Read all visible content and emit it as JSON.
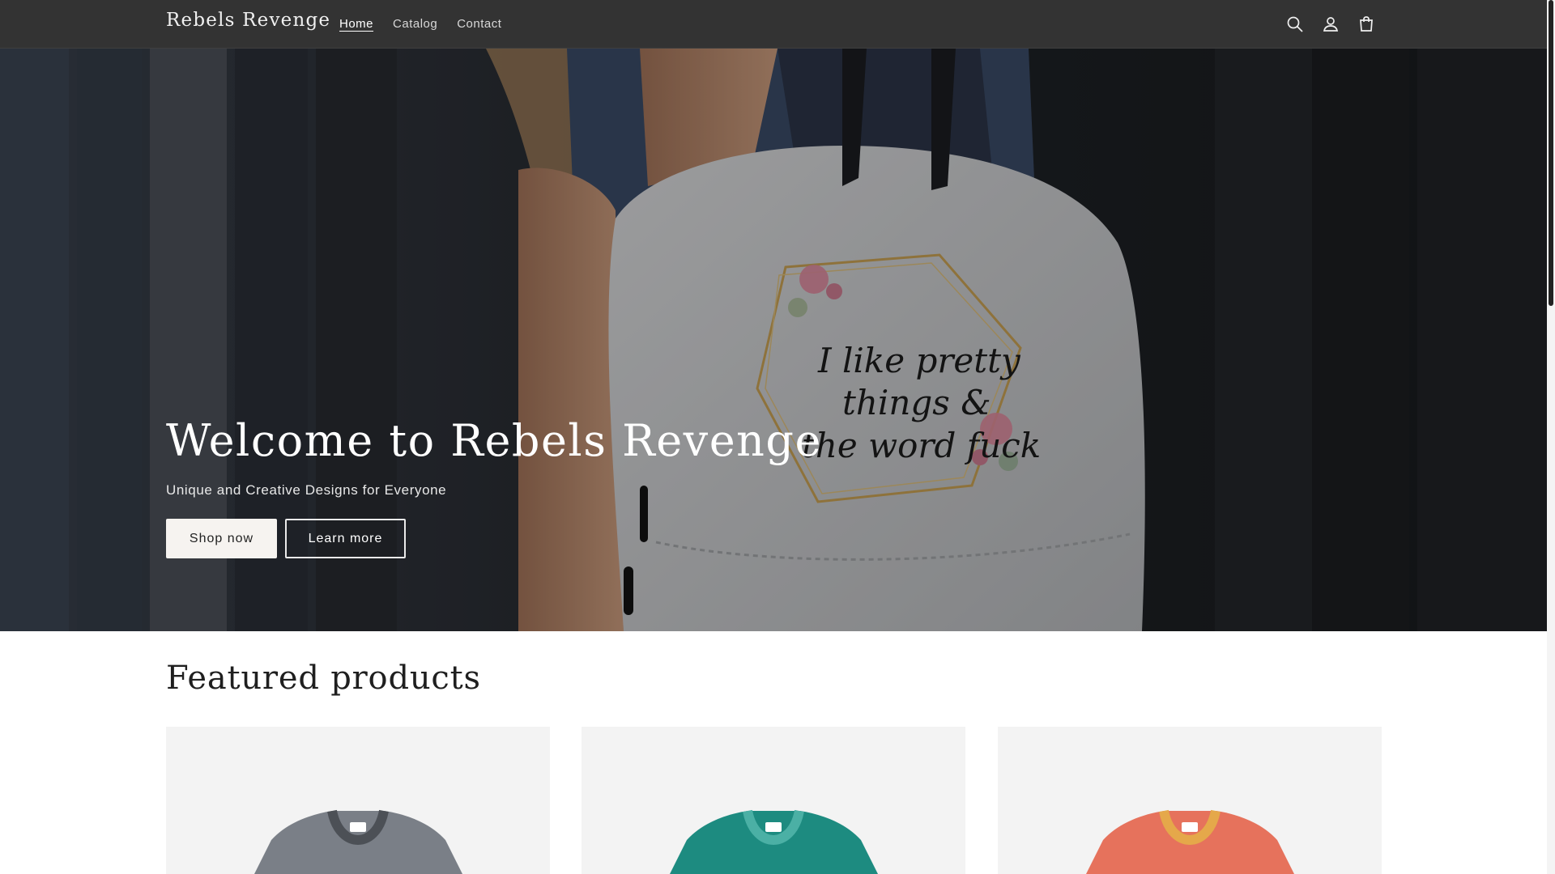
{
  "header": {
    "logo": "Rebels Revenge",
    "nav": [
      {
        "label": "Home",
        "active": true
      },
      {
        "label": "Catalog",
        "active": false
      },
      {
        "label": "Contact",
        "active": false
      }
    ],
    "icons": [
      "search-icon",
      "account-icon",
      "cart-icon"
    ]
  },
  "hero": {
    "title": "Welcome to Rebels Revenge",
    "subtitle": "Unique and Creative Designs for Everyone",
    "primary_button": "Shop now",
    "secondary_button": "Learn more",
    "print_text": [
      "I like pretty",
      "things &",
      "the word fuck"
    ]
  },
  "featured": {
    "title": "Featured products",
    "products": [
      {
        "color": "#7a7f87",
        "collar": "#4c5056"
      },
      {
        "color": "#1d8b80",
        "collar": "#4bb0a5"
      },
      {
        "color": "#e6725c",
        "collar": "#e5a84a"
      }
    ]
  },
  "colors": {
    "header_bg": "#333333",
    "button_light": "#f6f3f0"
  }
}
